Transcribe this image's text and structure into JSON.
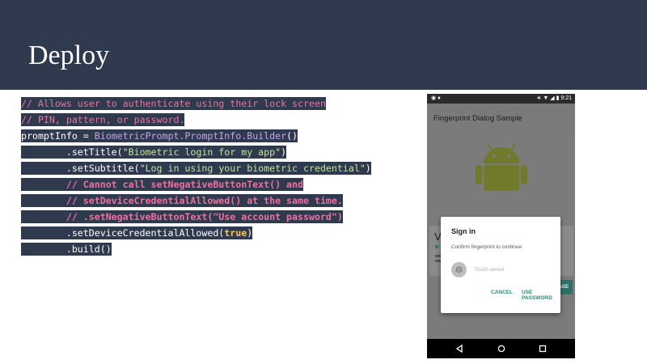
{
  "header": {
    "title": "Deploy"
  },
  "code": {
    "line1": "// Allows user to authenticate using their lock screen",
    "line2": "// PIN, pattern, or password.",
    "line3_a": "promptInfo = ",
    "line3_b": "BiometricPrompt.PromptInfo.Builder",
    "line3_c": "()",
    "line4_a": "        .setTitle(",
    "line4_b": "\"Biometric login for my app\"",
    "line4_c": ")",
    "line5_a": "        .setSubtitle(",
    "line5_b": "\"Log in using your biometric credential\"",
    "line5_c": ")",
    "line6": "        // Cannot call setNegativeButtonText() and",
    "line7": "        // setDeviceCredentialAllowed() at the same time.",
    "line8": "        // .setNegativeButtonText(\"Use account password\")",
    "line9_a": "        .setDeviceCredentialAllowed(",
    "line9_b": "true",
    "line9_c": ")",
    "line10": "        .build()"
  },
  "phone": {
    "status_time": "9:21",
    "app_title": "Fingerprint Dialog Sample",
    "card_letter": "V",
    "purchase_label": "PURCHASE",
    "dialog": {
      "title": "Sign in",
      "description": "Confirm fingerprint to continue",
      "sensor_label": "Touch sensor",
      "cancel_label": "CANCEL",
      "use_password_label": "USE PASSWORD"
    }
  },
  "colors": {
    "header_bg": "#2f3a4f",
    "comment": "#e8749f",
    "string": "#c6e39b",
    "keyword": "#f6c453",
    "accent": "#2a8a7a"
  },
  "icons": [
    "camera-icon",
    "android-notification-icon",
    "bluetooth-icon",
    "wifi-icon",
    "signal-icon",
    "battery-icon",
    "android-robot-icon",
    "fingerprint-icon",
    "back-icon",
    "home-icon",
    "recents-icon"
  ]
}
